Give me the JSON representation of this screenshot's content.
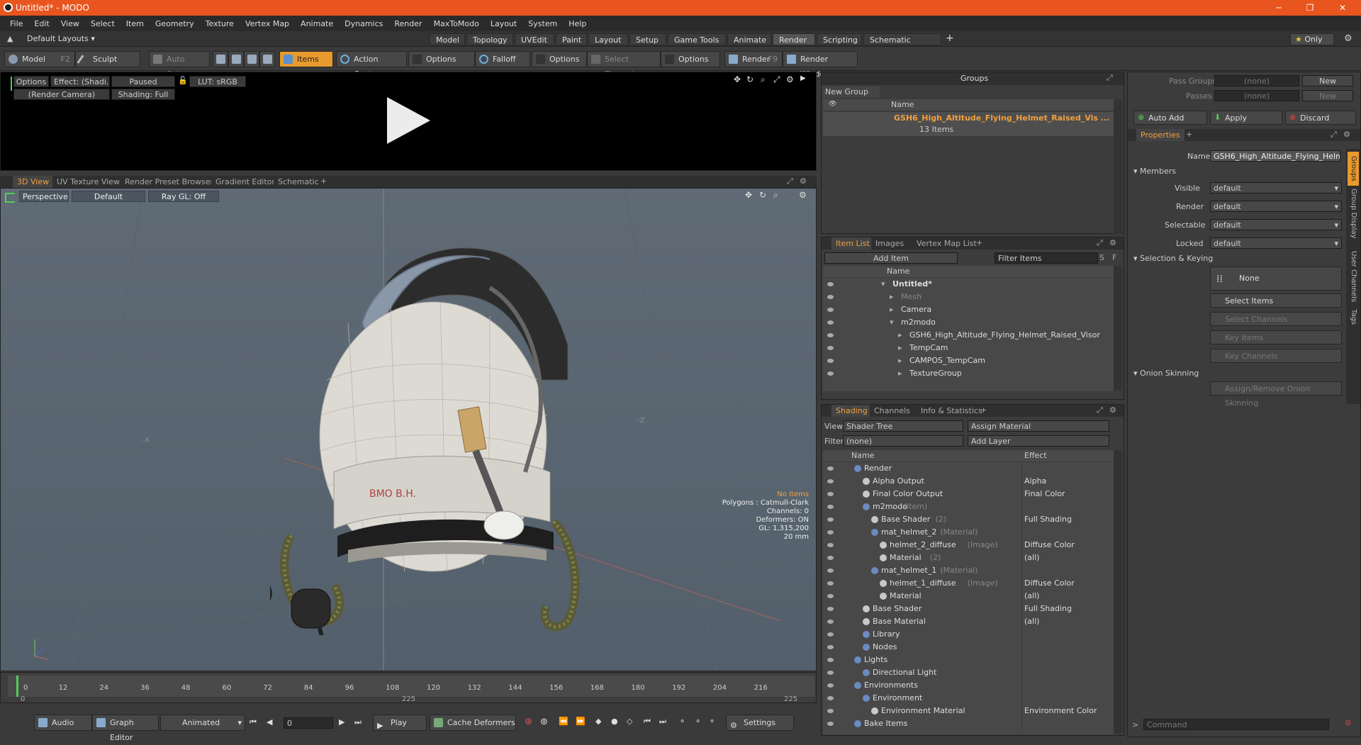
{
  "window": {
    "title": "Untitled* - MODO",
    "controls": [
      "─",
      "❐",
      "✕"
    ]
  },
  "menu": [
    "File",
    "Edit",
    "View",
    "Select",
    "Item",
    "Geometry",
    "Texture",
    "Vertex Map",
    "Animate",
    "Dynamics",
    "Render",
    "MaxToModo",
    "Layout",
    "System",
    "Help"
  ],
  "layouts": {
    "label": "Default Layouts",
    "tabs": [
      "Model",
      "Topology",
      "UVEdit",
      "Paint",
      "Layout",
      "Setup",
      "Game Tools",
      "Animate",
      "Render",
      "Scripting",
      "Schematic Fusion"
    ],
    "active": "Render",
    "only": "Only"
  },
  "toolbar": {
    "model": "Model",
    "model_key": "F2",
    "sculpt": "Sculpt",
    "auto_select": "Auto Select",
    "items": "Items",
    "action_center": "Action Center",
    "options1": "Options",
    "falloff": "Falloff",
    "options2": "Options",
    "select_through": "Select Through",
    "options3": "Options",
    "render": "Render",
    "render_key": "F9",
    "render_window": "Render Window"
  },
  "preview": {
    "options": "Options",
    "effect": "Effect: (Shadi...",
    "paused": "Paused",
    "lut": "LUT: sRGB",
    "camera": "(Render Camera)",
    "shading": "Shading: Full"
  },
  "viewport_tabs": {
    "tabs": [
      "3D View",
      "UV Texture View",
      "Render Preset Browser",
      "Gradient Editor",
      "Schematic"
    ],
    "active": "3D View"
  },
  "viewport": {
    "perspective": "Perspective",
    "default": "Default",
    "raygl": "Ray GL: Off",
    "axis_x": "-X",
    "axis_z": "-Z",
    "stats": {
      "no_items": "No Items",
      "polygons": "Polygons : Catmull-Clark",
      "channels": "Channels: 0",
      "deformers": "Deformers: ON",
      "gl": "GL: 1,315,200",
      "size": "20 mm"
    },
    "decal": "BMO B.H."
  },
  "timeline": {
    "ticks": [
      "0",
      "12",
      "24",
      "36",
      "48",
      "60",
      "72",
      "84",
      "96",
      "108",
      "120",
      "132",
      "144",
      "156",
      "168",
      "180",
      "192",
      "204",
      "216"
    ],
    "start": "0",
    "end": "225",
    "mid": "225"
  },
  "bottombar": {
    "audio": "Audio",
    "graph_editor": "Graph Editor",
    "animated": "Animated",
    "frame": "0",
    "play": "Play",
    "cache_deformers": "Cache Deformers",
    "settings": "Settings"
  },
  "groups": {
    "title": "Groups",
    "new_group": "New Group",
    "col_name": "Name",
    "item_name": "GSH6_High_Altitude_Flying_Helmet_Raised_Vis ...",
    "item_count": "13 Items"
  },
  "item_list": {
    "tabs": [
      "Item List",
      "Images",
      "Vertex Map List"
    ],
    "add_item": "Add Item",
    "filter": "Filter Items",
    "col_name": "Name",
    "rows": [
      {
        "label": "Untitled*",
        "indent": 0,
        "bold": true
      },
      {
        "label": "Mesh",
        "indent": 1,
        "dim": true
      },
      {
        "label": "Camera",
        "indent": 1
      },
      {
        "label": "m2modo",
        "indent": 1
      },
      {
        "label": "GSH6_High_Altitude_Flying_Helmet_Raised_Visor",
        "indent": 2
      },
      {
        "label": "TempCam",
        "indent": 2
      },
      {
        "label": "CAMPOS_TempCam",
        "indent": 2
      },
      {
        "label": "TextureGroup",
        "indent": 2
      }
    ]
  },
  "shading": {
    "tabs": [
      "Shading",
      "Channels",
      "Info & Statistics"
    ],
    "view_label": "View",
    "view_value": "Shader Tree",
    "assign_material": "Assign Material",
    "filter_label": "Filter",
    "filter_value": "(none)",
    "add_layer": "Add Layer",
    "col_name": "Name",
    "col_effect": "Effect",
    "rows": [
      {
        "label": "Render",
        "sub": "",
        "effect": "",
        "indent": 0
      },
      {
        "label": "Alpha Output",
        "sub": "",
        "effect": "Alpha",
        "indent": 1
      },
      {
        "label": "Final Color Output",
        "sub": "",
        "effect": "Final Color",
        "indent": 1
      },
      {
        "label": "m2modo",
        "sub": "(Item)",
        "effect": "",
        "indent": 1
      },
      {
        "label": "Base Shader",
        "sub": "(2)",
        "effect": "Full Shading",
        "indent": 2
      },
      {
        "label": "mat_helmet_2",
        "sub": "(Material)",
        "effect": "",
        "indent": 2
      },
      {
        "label": "helmet_2_diffuse",
        "sub": "(Image)",
        "effect": "Diffuse Color",
        "indent": 3
      },
      {
        "label": "Material",
        "sub": "(2)",
        "effect": "(all)",
        "indent": 3
      },
      {
        "label": "mat_helmet_1",
        "sub": "(Material)",
        "effect": "",
        "indent": 2
      },
      {
        "label": "helmet_1_diffuse",
        "sub": "(Image)",
        "effect": "Diffuse Color",
        "indent": 3
      },
      {
        "label": "Material",
        "sub": "",
        "effect": "(all)",
        "indent": 3
      },
      {
        "label": "Base Shader",
        "sub": "",
        "effect": "Full Shading",
        "indent": 1
      },
      {
        "label": "Base Material",
        "sub": "",
        "effect": "(all)",
        "indent": 1
      },
      {
        "label": "Library",
        "sub": "",
        "effect": "",
        "indent": 1
      },
      {
        "label": "Nodes",
        "sub": "",
        "effect": "",
        "indent": 1
      },
      {
        "label": "Lights",
        "sub": "",
        "effect": "",
        "indent": 0
      },
      {
        "label": "Directional Light",
        "sub": "",
        "effect": "",
        "indent": 1
      },
      {
        "label": "Environments",
        "sub": "",
        "effect": "",
        "indent": 0
      },
      {
        "label": "Environment",
        "sub": "",
        "effect": "",
        "indent": 1
      },
      {
        "label": "Environment Material",
        "sub": "",
        "effect": "Environment Color",
        "indent": 2
      },
      {
        "label": "Bake Items",
        "sub": "",
        "effect": "",
        "indent": 0
      }
    ]
  },
  "props": {
    "pass_groups": "Pass Groups",
    "passes": "Passes",
    "none": "(none)",
    "new": "New",
    "auto_add": "Auto Add",
    "apply": "Apply",
    "discard": "Discard",
    "tab": "Properties",
    "name_label": "Name",
    "name_value": "GSH6_High_Altitude_Flying_Helmet_",
    "members": "Members",
    "visible": "Visible",
    "render": "Render",
    "selectable": "Selectable",
    "locked": "Locked",
    "default": "default",
    "selection_keying": "Selection & Keying",
    "none_btn": "None",
    "select_items": "Select Items",
    "select_channels": "Select Channels",
    "key_items": "Key Items",
    "key_channels": "Key Channels",
    "onion": "Onion Skinning",
    "assign_onion": "Assign/Remove Onion Skinning",
    "side_tabs": [
      "Groups",
      "Group Display",
      "User Channels",
      "Tags"
    ],
    "command": "Command"
  }
}
